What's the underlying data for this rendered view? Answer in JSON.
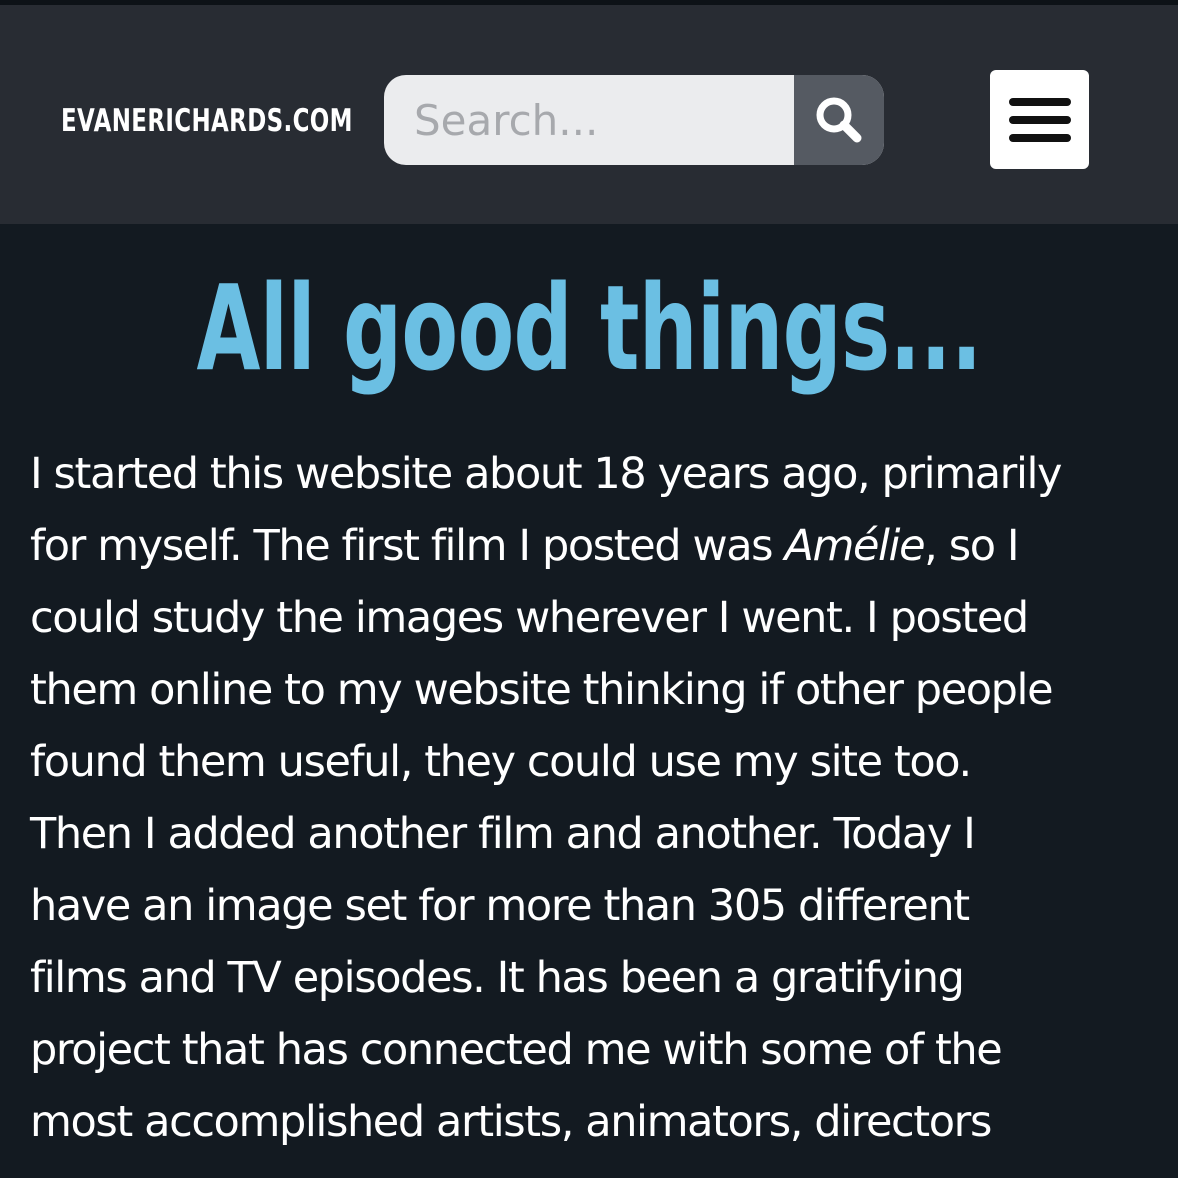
{
  "header": {
    "site_name": "EVANERICHARDS.COM",
    "search": {
      "placeholder": "Search...",
      "button_icon": "search-icon"
    },
    "menu_icon": "hamburger-menu-icon"
  },
  "colors": {
    "header_background": "#282c33",
    "page_background": "#131a21",
    "title_accent": "#6bbfe3",
    "search_button": "#555a62"
  },
  "article": {
    "title": "All good things...",
    "body_lines": [
      "I started this website about 18 years ago, primarily",
      "for myself. The first film I posted was ",
      "Amélie",
      ", so I",
      "could study the images wherever I went. I posted",
      "them online to my website thinking if other people",
      "found them useful, they could use my site too.",
      "Then I added another film and another. Today I",
      "have an image set for more than 305 different",
      "films and TV episodes. It has been a gratifying",
      "project that has connected me with some of the",
      "most accomplished artists, animators, directors"
    ]
  }
}
